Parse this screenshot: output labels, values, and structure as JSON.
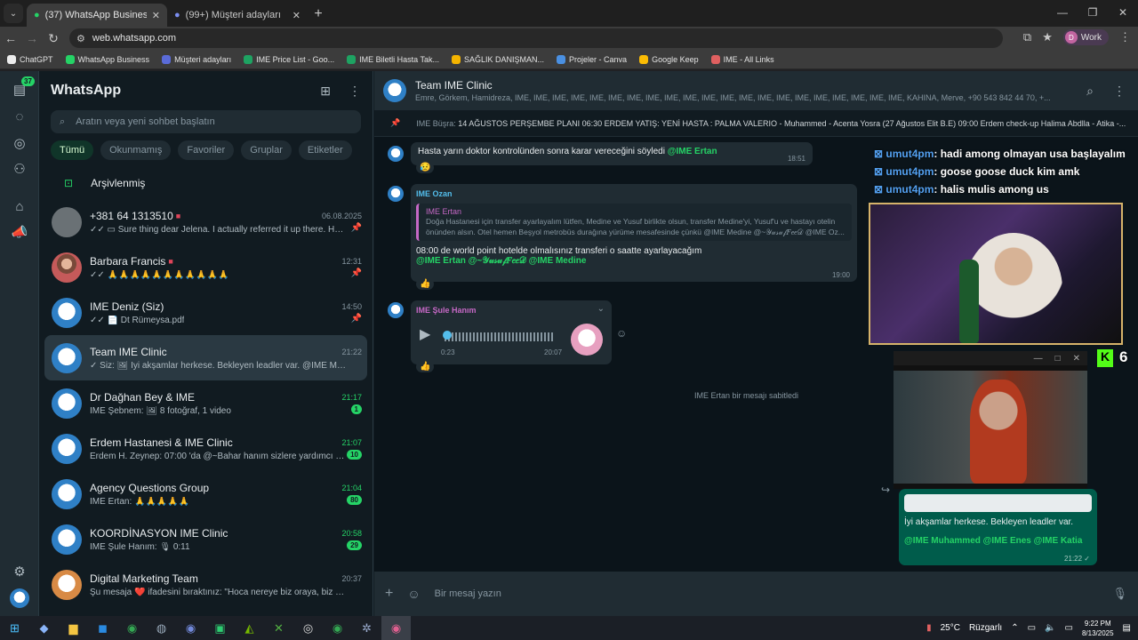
{
  "browser": {
    "tabs": [
      {
        "title": "(37) WhatsApp Business",
        "active": true
      },
      {
        "title": "(99+) Müşteri adayları",
        "active": false
      }
    ],
    "url": "web.whatsapp.com",
    "profile_initial": "D",
    "profile_label": "Work",
    "bookmarks": [
      {
        "label": "ChatGPT",
        "color": "#ececec"
      },
      {
        "label": "WhatsApp Business",
        "color": "#25d366"
      },
      {
        "label": "Müşteri adayları",
        "color": "#5a6bd8"
      },
      {
        "label": "IME Price List - Goo...",
        "color": "#1ea362"
      },
      {
        "label": "IME Biletli Hasta Tak...",
        "color": "#1ea362"
      },
      {
        "label": "SAĞLIK DANIŞMAN...",
        "color": "#f4b400"
      },
      {
        "label": "Projeler - Canva",
        "color": "#4a90e2"
      },
      {
        "label": "Google Keep",
        "color": "#fbbc04"
      },
      {
        "label": "IME - All Links",
        "color": "#e06060"
      }
    ]
  },
  "rail": {
    "badge": "37"
  },
  "sidebar": {
    "title": "WhatsApp",
    "search_placeholder": "Aratın veya yeni sohbet başlatın",
    "filters": [
      "Tümü",
      "Okunmamış",
      "Favoriler",
      "Gruplar",
      "Etiketler"
    ],
    "archived": "Arşivlenmiş",
    "chats": [
      {
        "name": "+381 64 1313510",
        "time": "06.08.2025",
        "msg": "✓✓ ▭ Sure thing dear Jelena. I actually referred it up there. Here i...",
        "badge": "",
        "green": false,
        "pinned": true,
        "avatar": "default",
        "tag": true
      },
      {
        "name": "Barbara Francis",
        "time": "12:31",
        "msg": "✓✓ 🙏🙏🙏🙏🙏🙏🙏🙏🙏🙏🙏",
        "badge": "",
        "green": false,
        "pinned": true,
        "avatar": "person",
        "tag": true
      },
      {
        "name": "IME Deniz (Siz)",
        "time": "14:50",
        "msg": "✓✓ 📄 Dt Rümeysa.pdf",
        "badge": "",
        "green": false,
        "pinned": true,
        "avatar": "ime",
        "tag": false
      },
      {
        "name": "Team IME Clinic",
        "time": "21:22",
        "msg": "✓ Siz: 🖼 İyi akşamlar herkese. Bekleyen leadler var. @IME Muhamm...",
        "badge": "",
        "green": false,
        "pinned": false,
        "avatar": "ime",
        "tag": false,
        "selected": true
      },
      {
        "name": "Dr Dağhan Bey & IME",
        "time": "21:17",
        "msg": "IME Şebnem: 🖼 8 fotoğraf, 1 video",
        "badge": "1",
        "green": true,
        "pinned": false,
        "avatar": "ime",
        "tag": false
      },
      {
        "name": "Erdem Hastanesi & IME Clinic",
        "time": "21:07",
        "msg": "Erdem H. Zeynep: 07:00 'da @~Bahar hanım sizlere yardımcı olac...",
        "badge": "10",
        "green": true,
        "pinned": false,
        "avatar": "ime",
        "tag": false
      },
      {
        "name": "Agency Questions Group",
        "time": "21:04",
        "msg": "IME Ertan: 🙏🙏🙏🙏🙏",
        "badge": "80",
        "green": true,
        "pinned": false,
        "avatar": "ime",
        "tag": false
      },
      {
        "name": "KOORDİNASYON IME Clinic",
        "time": "20:58",
        "msg": "IME Şule Hanım: 🎙 0:11",
        "badge": "29",
        "green": true,
        "pinned": false,
        "avatar": "ime",
        "tag": false
      },
      {
        "name": "Digital Marketing Team",
        "time": "20:37",
        "msg": "Şu mesaja ❤️ ifadesini bıraktınız: \"Hoca nereye biz oraya, biz nereye ...",
        "badge": "",
        "green": false,
        "pinned": false,
        "avatar": "orange",
        "tag": false
      }
    ]
  },
  "conversation": {
    "title": "Team IME Clinic",
    "members": "Emre, Görkem, Hamidreza, IME, IME, IME, IME, IME, IME, IME, IME, IME, IME, IME, IME, IME, IME, IME, IME, IME, IME, IME, IME, IME, KAHINA, Merve, +90 543 842 44 70, +...",
    "pinned_label": "IME Büşra:",
    "pinned_text": "14  AĞUSTOS PERŞEMBE  PLANI 06:30 ERDEM YATIŞ: YENİ HASTA : PALMA VALERIO - Muhammed - Acenta Yosra (27 Ağustos  Elit B.E) 09:00 Erdem check-up Halima Abdlla - Atika -...",
    "msg1_text": "Hasta yarın doktor kontrolünden sonra karar vereceğini söyledi",
    "msg1_mention": "@IME Ertan",
    "msg1_time": "18:51",
    "msg1_react": "😥",
    "msg2_sender": "IME Ozan",
    "msg2_quote_sender": "IME Ertan",
    "msg2_quote": "Doğa Hastanesi için transfer ayarlayalım lütfen, Medine ve Yusuf birlikte olsun, transfer Medine'yi, Yusuf'u ve hastayı otelin önünden alsın. Otel hemen Beşyol metrobüs durağına yürüme mesafesinde çünkü @IME Medine @~𝒴𝓊𝓈𝓊𝒻𝐹𝑒𝑒𝒟 @IME Oz...",
    "msg2_text": "08:00 de world point hotelde olmalısınız transferi o saatte ayarlayacağım",
    "msg2_mentions": "@IME Ertan @~𝒴𝓊𝓈𝓊𝒻𝐹𝑒𝑒𝒟 @IME Medine",
    "msg2_time": "19:00",
    "msg2_react": "👍",
    "msg3_sender": "IME Şule Hanım",
    "msg3_elapsed": "0:23",
    "msg3_time": "20:07",
    "msg3_react": "👍",
    "system": "IME Ertan bir mesajı sabitledi",
    "out_text": "İyi akşamlar herkese. Bekleyen leadler var.",
    "out_mentions": "@IME Muhammed @IME Enes @IME Katia",
    "out_time": "21:22 ✓",
    "composer_placeholder": "Bir mesaj yazın"
  },
  "overlay": {
    "chat": [
      {
        "user": "umut4pm",
        "text": ": hadi among olmayan usa başlayalım"
      },
      {
        "user": "umut4pm",
        "text": ": goose goose duck kim amk"
      },
      {
        "user": "umut4pm",
        "text": ": halis mulis among us"
      }
    ],
    "kick_count": "6"
  },
  "taskbar": {
    "weather": "25°C",
    "weather_label": "Rüzgarlı",
    "time": "9:22 PM",
    "date": "8/13/2025"
  }
}
